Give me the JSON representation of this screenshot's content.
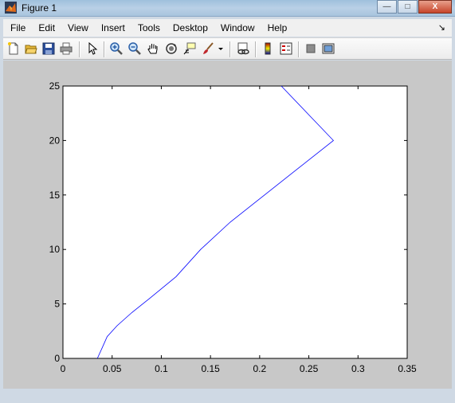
{
  "window": {
    "title": "Figure 1",
    "minimize_glyph": "—",
    "maximize_glyph": "□",
    "close_glyph": "X"
  },
  "menubar": {
    "items": [
      "File",
      "Edit",
      "View",
      "Insert",
      "Tools",
      "Desktop",
      "Window",
      "Help"
    ],
    "dock_arrow": "↘"
  },
  "toolbar": {
    "icons": [
      "new-figure-icon",
      "open-file-icon",
      "save-figure-icon",
      "print-figure-icon",
      "edit-plot-icon",
      "zoom-in-icon",
      "zoom-out-icon",
      "pan-icon",
      "rotate-3d-icon",
      "data-cursor-icon",
      "brush-icon",
      "brush-dropdown-icon",
      "link-plot-icon",
      "insert-colorbar-icon",
      "insert-legend-icon",
      "hide-plot-tools-icon",
      "show-plot-tools-icon"
    ]
  },
  "colors": {
    "figure_background": "#c8c8c8",
    "axes_background": "#ffffff",
    "line": "#0000ff"
  },
  "chart_data": {
    "type": "line",
    "title": "",
    "xlabel": "",
    "ylabel": "",
    "xlim": [
      0,
      0.35
    ],
    "ylim": [
      0,
      25
    ],
    "xticks": [
      0,
      0.05,
      0.1,
      0.15,
      0.2,
      0.25,
      0.3,
      0.35
    ],
    "xtick_labels": [
      "0",
      "0.05",
      "0.1",
      "0.15",
      "0.2",
      "0.25",
      "0.3",
      "0.35"
    ],
    "yticks": [
      0,
      5,
      10,
      15,
      20,
      25
    ],
    "ytick_labels": [
      "0",
      "5",
      "10",
      "15",
      "20",
      "25"
    ],
    "grid": false,
    "series": [
      {
        "x": [
          0.035,
          0.04,
          0.045,
          0.055,
          0.07,
          0.088,
          0.115,
          0.14,
          0.17,
          0.205,
          0.24,
          0.275,
          0.222
        ],
        "y": [
          0,
          1,
          2,
          3,
          4.2,
          5.5,
          7.5,
          10,
          12.5,
          15,
          17.5,
          20,
          25
        ]
      }
    ]
  }
}
